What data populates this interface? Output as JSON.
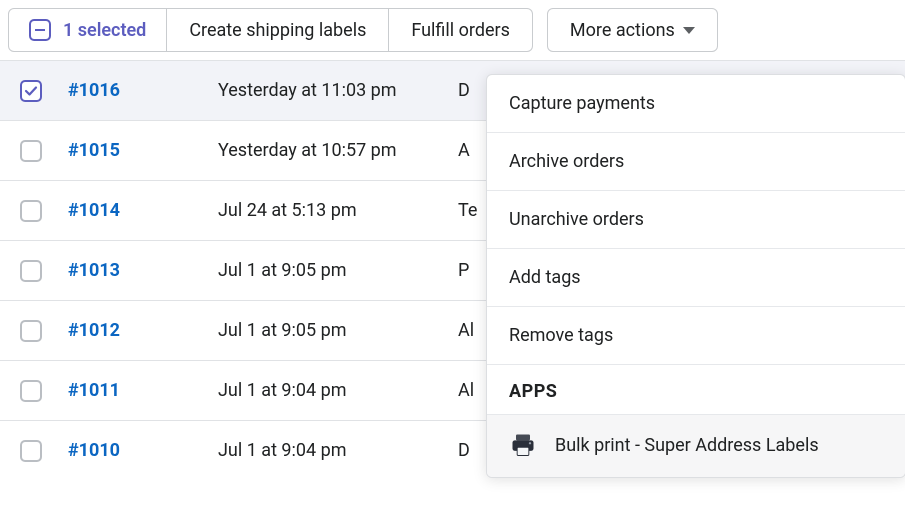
{
  "toolbar": {
    "selected_label": "1 selected",
    "create_labels": "Create shipping labels",
    "fulfill_orders": "Fulfill orders",
    "more_actions": "More actions"
  },
  "orders": [
    {
      "id": "#1016",
      "date": "Yesterday at 11:03 pm",
      "extra": "D",
      "checked": true
    },
    {
      "id": "#1015",
      "date": "Yesterday at 10:57 pm",
      "extra": "A",
      "checked": false
    },
    {
      "id": "#1014",
      "date": "Jul 24 at 5:13 pm",
      "extra": "Te",
      "checked": false
    },
    {
      "id": "#1013",
      "date": "Jul 1 at 9:05 pm",
      "extra": "P",
      "checked": false
    },
    {
      "id": "#1012",
      "date": "Jul 1 at 9:05 pm",
      "extra": "Al",
      "checked": false
    },
    {
      "id": "#1011",
      "date": "Jul 1 at 9:04 pm",
      "extra": "Al",
      "checked": false
    },
    {
      "id": "#1010",
      "date": "Jul 1 at 9:04 pm",
      "extra": "D",
      "checked": false
    }
  ],
  "dropdown": {
    "items": [
      "Capture payments",
      "Archive orders",
      "Unarchive orders",
      "Add tags",
      "Remove tags"
    ],
    "section_label": "APPS",
    "app_label": "Bulk print - Super Address Labels"
  }
}
